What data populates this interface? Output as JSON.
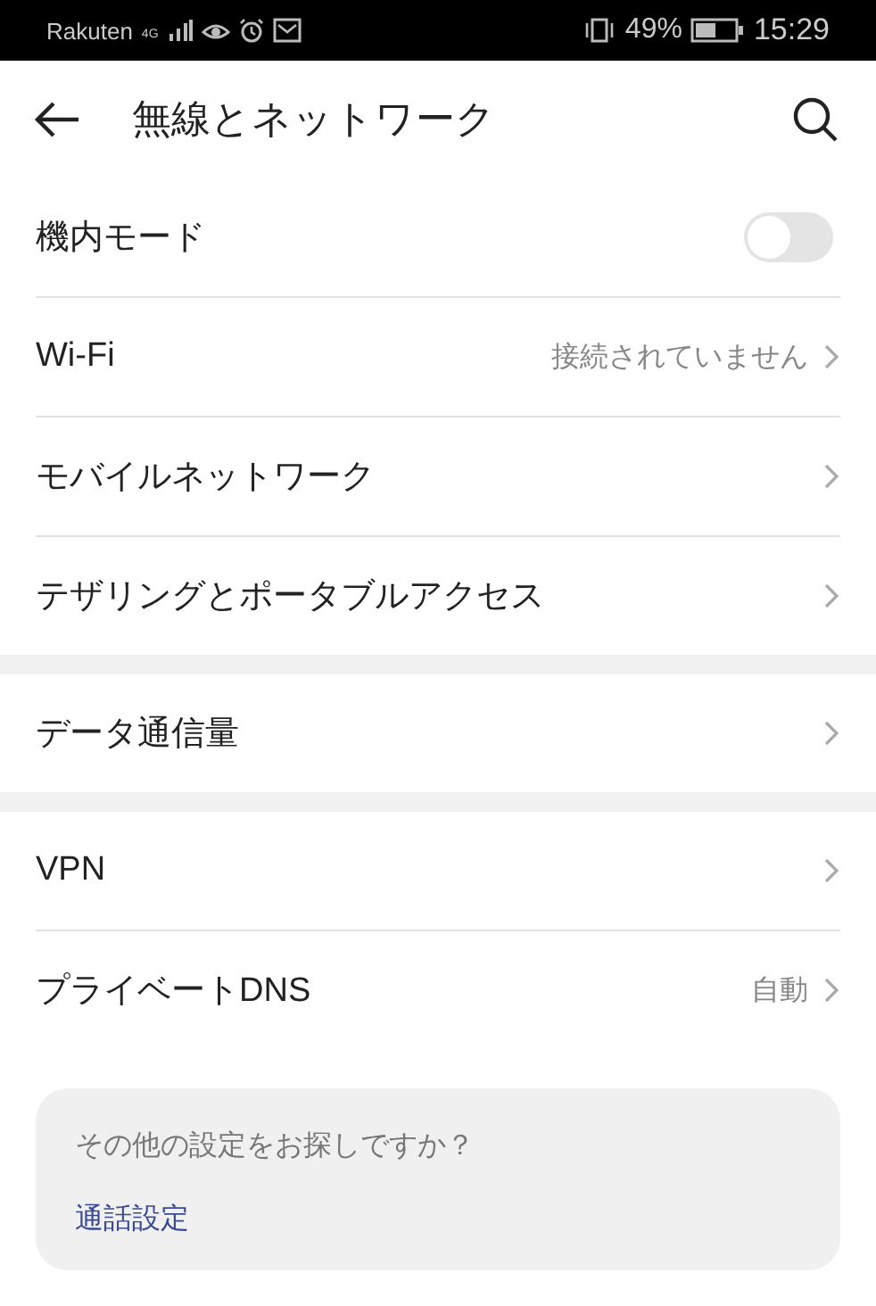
{
  "status_bar": {
    "carrier": "Rakuten",
    "network": "4G",
    "battery": "49%",
    "time": "15:29"
  },
  "header": {
    "title": "無線とネットワーク"
  },
  "groups": [
    {
      "items": [
        {
          "kind": "toggle",
          "label": "機内モード",
          "on": false
        },
        {
          "kind": "link",
          "label": "Wi-Fi",
          "value": "接続されていません"
        },
        {
          "kind": "link",
          "label": "モバイルネットワーク"
        },
        {
          "kind": "link",
          "label": "テザリングとポータブルアクセス"
        }
      ]
    },
    {
      "items": [
        {
          "kind": "link",
          "label": "データ通信量"
        }
      ]
    },
    {
      "items": [
        {
          "kind": "link",
          "label": "VPN"
        },
        {
          "kind": "link",
          "label": "プライベートDNS",
          "value": "自動"
        }
      ]
    }
  ],
  "suggestion": {
    "question": "その他の設定をお探しですか？",
    "link": "通話設定"
  }
}
